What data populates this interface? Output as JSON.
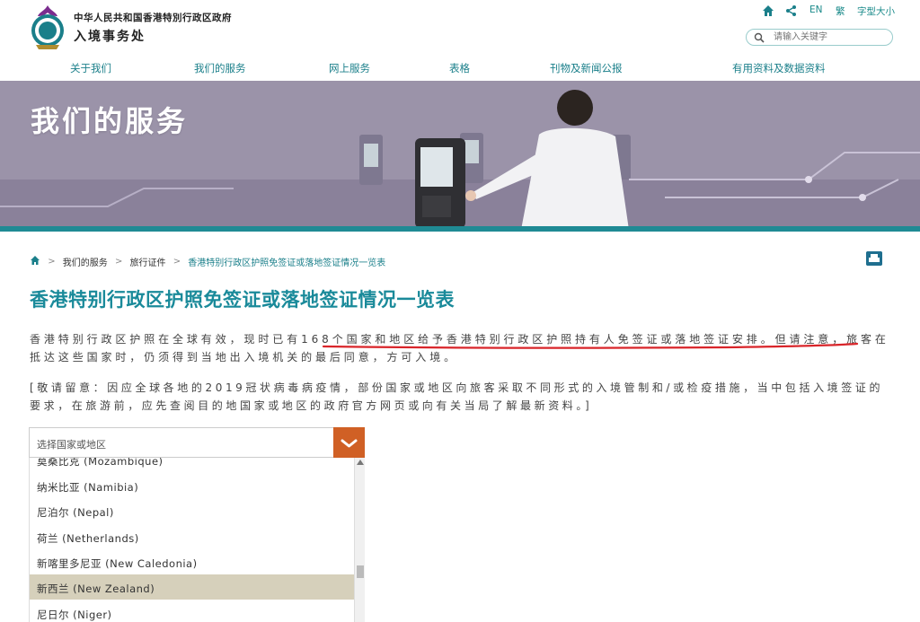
{
  "header": {
    "gov_name": "中华人民共和国香港特別行政区政府",
    "dept_name": "入境事务处",
    "lang_en": "EN",
    "lang_tc": "繁",
    "font_size": "字型大小",
    "search_placeholder": "请输入关键字"
  },
  "nav": {
    "items": [
      {
        "label": "关于我们"
      },
      {
        "label": "我们的服务"
      },
      {
        "label": "网上服务"
      },
      {
        "label": "表格"
      },
      {
        "label": "刊物及新闻公报"
      },
      {
        "label": "有用资料及数据资料"
      }
    ]
  },
  "banner": {
    "title": "我们的服务"
  },
  "breadcrumb": {
    "sep": ">",
    "items": [
      "我们的服务",
      "旅行证件",
      "香港特别行政区护照免签证或落地签证情况一览表"
    ]
  },
  "page_title": "香港特别行政区护照免签证或落地签证情况一览表",
  "paragraphs": {
    "p1": "香港特别行政区护照在全球有效，现时已有168个国家和地区给予香港特别行政区护照持有人免签证或落地签证安排。但请注意，旅客在抵达这些国家时，仍须得到当地出入境机关的最后同意，方可入境。",
    "p2": "[敬请留意：因应全球各地的2019冠状病毒病疫情，部份国家或地区向旅客采取不同形式的入境管制和/或检疫措施，当中包括入境签证的要求，在旅游前，应先查阅目的地国家或地区的政府官方网页或向有关当局了解最新资料。]"
  },
  "selector": {
    "placeholder": "选择国家或地区",
    "options": [
      {
        "label": "莫桑比克 (Mozambique)",
        "selected": false
      },
      {
        "label": "纳米比亚 (Namibia)",
        "selected": false
      },
      {
        "label": "尼泊尔 (Nepal)",
        "selected": false
      },
      {
        "label": "荷兰 (Netherlands)",
        "selected": false
      },
      {
        "label": "新喀里多尼亚 (New Caledonia)",
        "selected": false
      },
      {
        "label": "新西兰 (New Zealand)",
        "selected": true
      },
      {
        "label": "尼日尔 (Niger)",
        "selected": false
      }
    ]
  },
  "colors": {
    "accent": "#1a8a9a",
    "dropdown_button": "#d06025",
    "selected_row": "#d6d0bb",
    "underline": "#d9252a"
  }
}
